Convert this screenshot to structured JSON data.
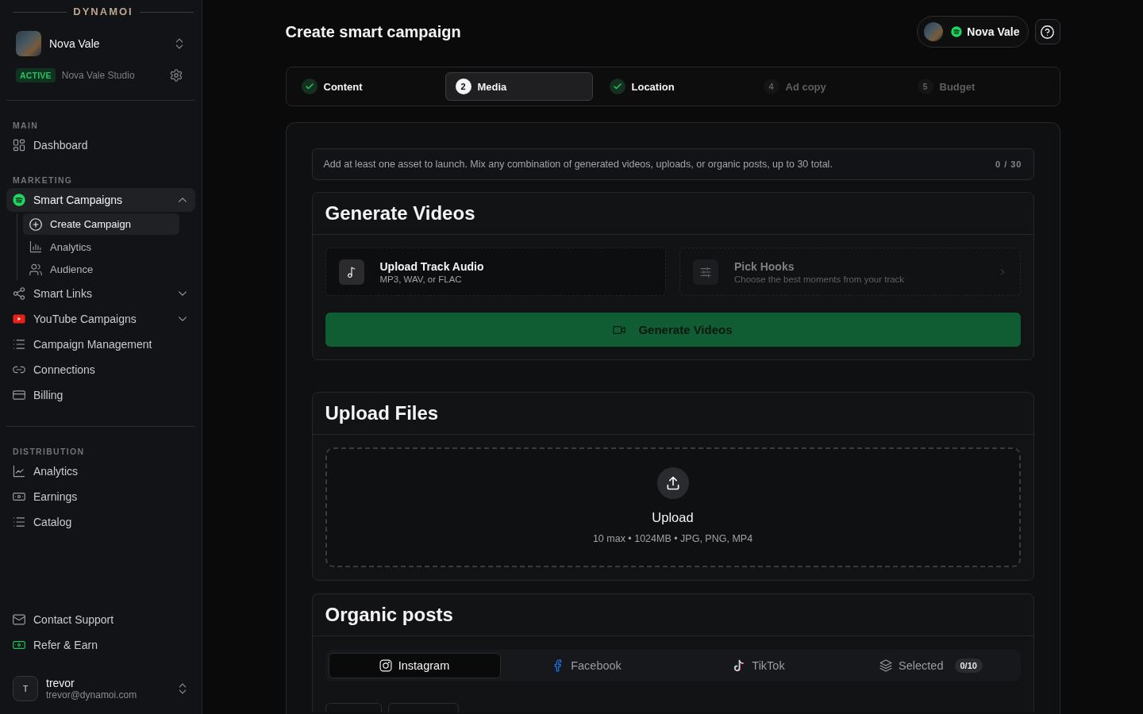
{
  "sidebar": {
    "brand": "DYNAMOI",
    "artist": {
      "name": "Nova Vale",
      "status": "ACTIVE",
      "studio": "Nova Vale Studio"
    },
    "nav": [
      {
        "sections": [
          {
            "label": "MAIN",
            "items": [
              {
                "label": "Dashboard",
                "kind": "link",
                "selected": false
              }
            ]
          },
          {
            "label": "MARKETING",
            "items": [
              {
                "label": "Smart Campaigns",
                "kind": "group",
                "selected": true,
                "expanded": true,
                "children": [
                  {
                    "label": "Create Campaign",
                    "selected": true
                  },
                  {
                    "label": "Analytics",
                    "selected": false
                  },
                  {
                    "label": "Audience",
                    "selected": false
                  }
                ]
              },
              {
                "label": "Smart Links",
                "kind": "group",
                "selected": false,
                "expanded": false
              },
              {
                "label": "YouTube Campaigns",
                "kind": "group",
                "selected": false,
                "expanded": false
              },
              {
                "label": "Campaign Management",
                "kind": "link",
                "selected": false
              },
              {
                "label": "Connections",
                "kind": "link",
                "selected": false
              },
              {
                "label": "Billing",
                "kind": "link",
                "selected": false
              }
            ]
          }
        ]
      },
      {
        "sections": [
          {
            "label": "DISTRIBUTION",
            "items": [
              {
                "label": "Analytics",
                "kind": "link",
                "selected": false
              },
              {
                "label": "Earnings",
                "kind": "link",
                "selected": false
              },
              {
                "label": "Catalog",
                "kind": "link",
                "selected": false
              }
            ]
          }
        ]
      }
    ],
    "footer_links": [
      {
        "label": "Contact Support",
        "selected": false
      },
      {
        "label": "Refer & Earn",
        "selected": false
      }
    ],
    "user": {
      "initial": "T",
      "name": "trevor",
      "email": "trevor@dynamoi.com"
    }
  },
  "header": {
    "title": "Create smart campaign",
    "artist": "Nova Vale"
  },
  "stepper": {
    "steps": [
      {
        "label": "Content",
        "completed": true,
        "selected": false
      },
      {
        "number": "2",
        "label": "Media",
        "completed": false,
        "selected": true
      },
      {
        "label": "Location",
        "completed": true,
        "selected": false
      },
      {
        "number": "4",
        "label": "Ad copy",
        "completed": false,
        "selected": false
      },
      {
        "number": "5",
        "label": "Budget",
        "completed": false,
        "selected": false
      }
    ]
  },
  "assets_notice": {
    "text": "Add at least one asset to launch. Mix any combination of generated videos, uploads, or organic posts, up to 30 total.",
    "counter": "0 / 30"
  },
  "generate_videos": {
    "title": "Generate Videos",
    "options": [
      {
        "kind": "upload",
        "title": "Upload Track Audio",
        "subtitle": "MP3, WAV, or FLAC",
        "disabled": false
      },
      {
        "kind": "navigate",
        "title": "Pick Hooks",
        "subtitle": "Choose the best moments from your track",
        "disabled": true
      }
    ],
    "button": "Generate Videos"
  },
  "upload_files": {
    "title": "Upload Files",
    "dropzone": {
      "label": "Upload",
      "hint": "10 max • 1024MB • JPG, PNG, MP4"
    }
  },
  "organic_posts": {
    "title": "Organic posts",
    "tabs": [
      {
        "label": "Instagram",
        "selected": true
      },
      {
        "label": "Facebook",
        "selected": false
      },
      {
        "label": "TikTok",
        "selected": false
      },
      {
        "label": "Selected",
        "badge": "0/10",
        "selected": false
      }
    ],
    "toolbar": [
      {
        "kind": "button"
      },
      {
        "kind": "button"
      }
    ]
  }
}
